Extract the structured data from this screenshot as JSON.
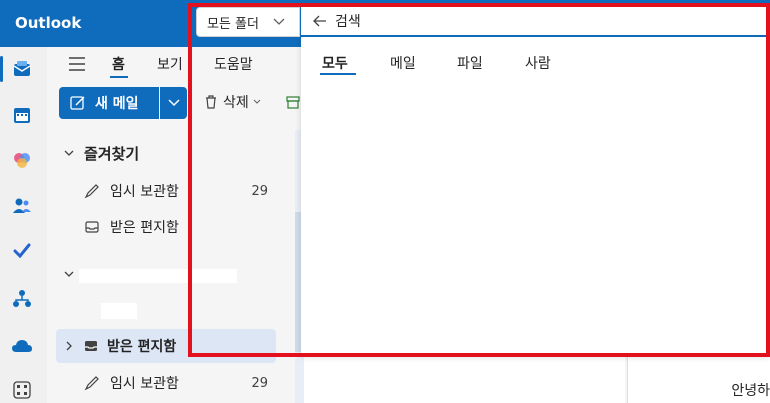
{
  "app": {
    "title": "Outlook"
  },
  "nav": {
    "tabs": [
      "홈",
      "보기",
      "도움말"
    ]
  },
  "ribbon": {
    "new_mail": "새 메일",
    "delete": "삭제"
  },
  "folders": {
    "favorites_header": "즐겨찾기",
    "items": [
      {
        "label": "임시 보관함",
        "count": "29"
      },
      {
        "label": "받은 편지함",
        "count": ""
      },
      {
        "label": "받은 편지함",
        "count": ""
      },
      {
        "label": "임시 보관함",
        "count": "29"
      }
    ]
  },
  "search": {
    "scope": "모든 폴더",
    "placeholder": "검색",
    "tabs": [
      "모두",
      "메일",
      "파일",
      "사람"
    ]
  },
  "reading": {
    "text": "안녕하"
  },
  "colors": {
    "accent": "#0f6cbd",
    "highlight": "#e3101e"
  },
  "icons": [
    "mail-icon",
    "calendar-icon",
    "copilot-icon",
    "people-icon",
    "todo-icon",
    "org-icon",
    "onedrive-icon",
    "apps-icon"
  ]
}
